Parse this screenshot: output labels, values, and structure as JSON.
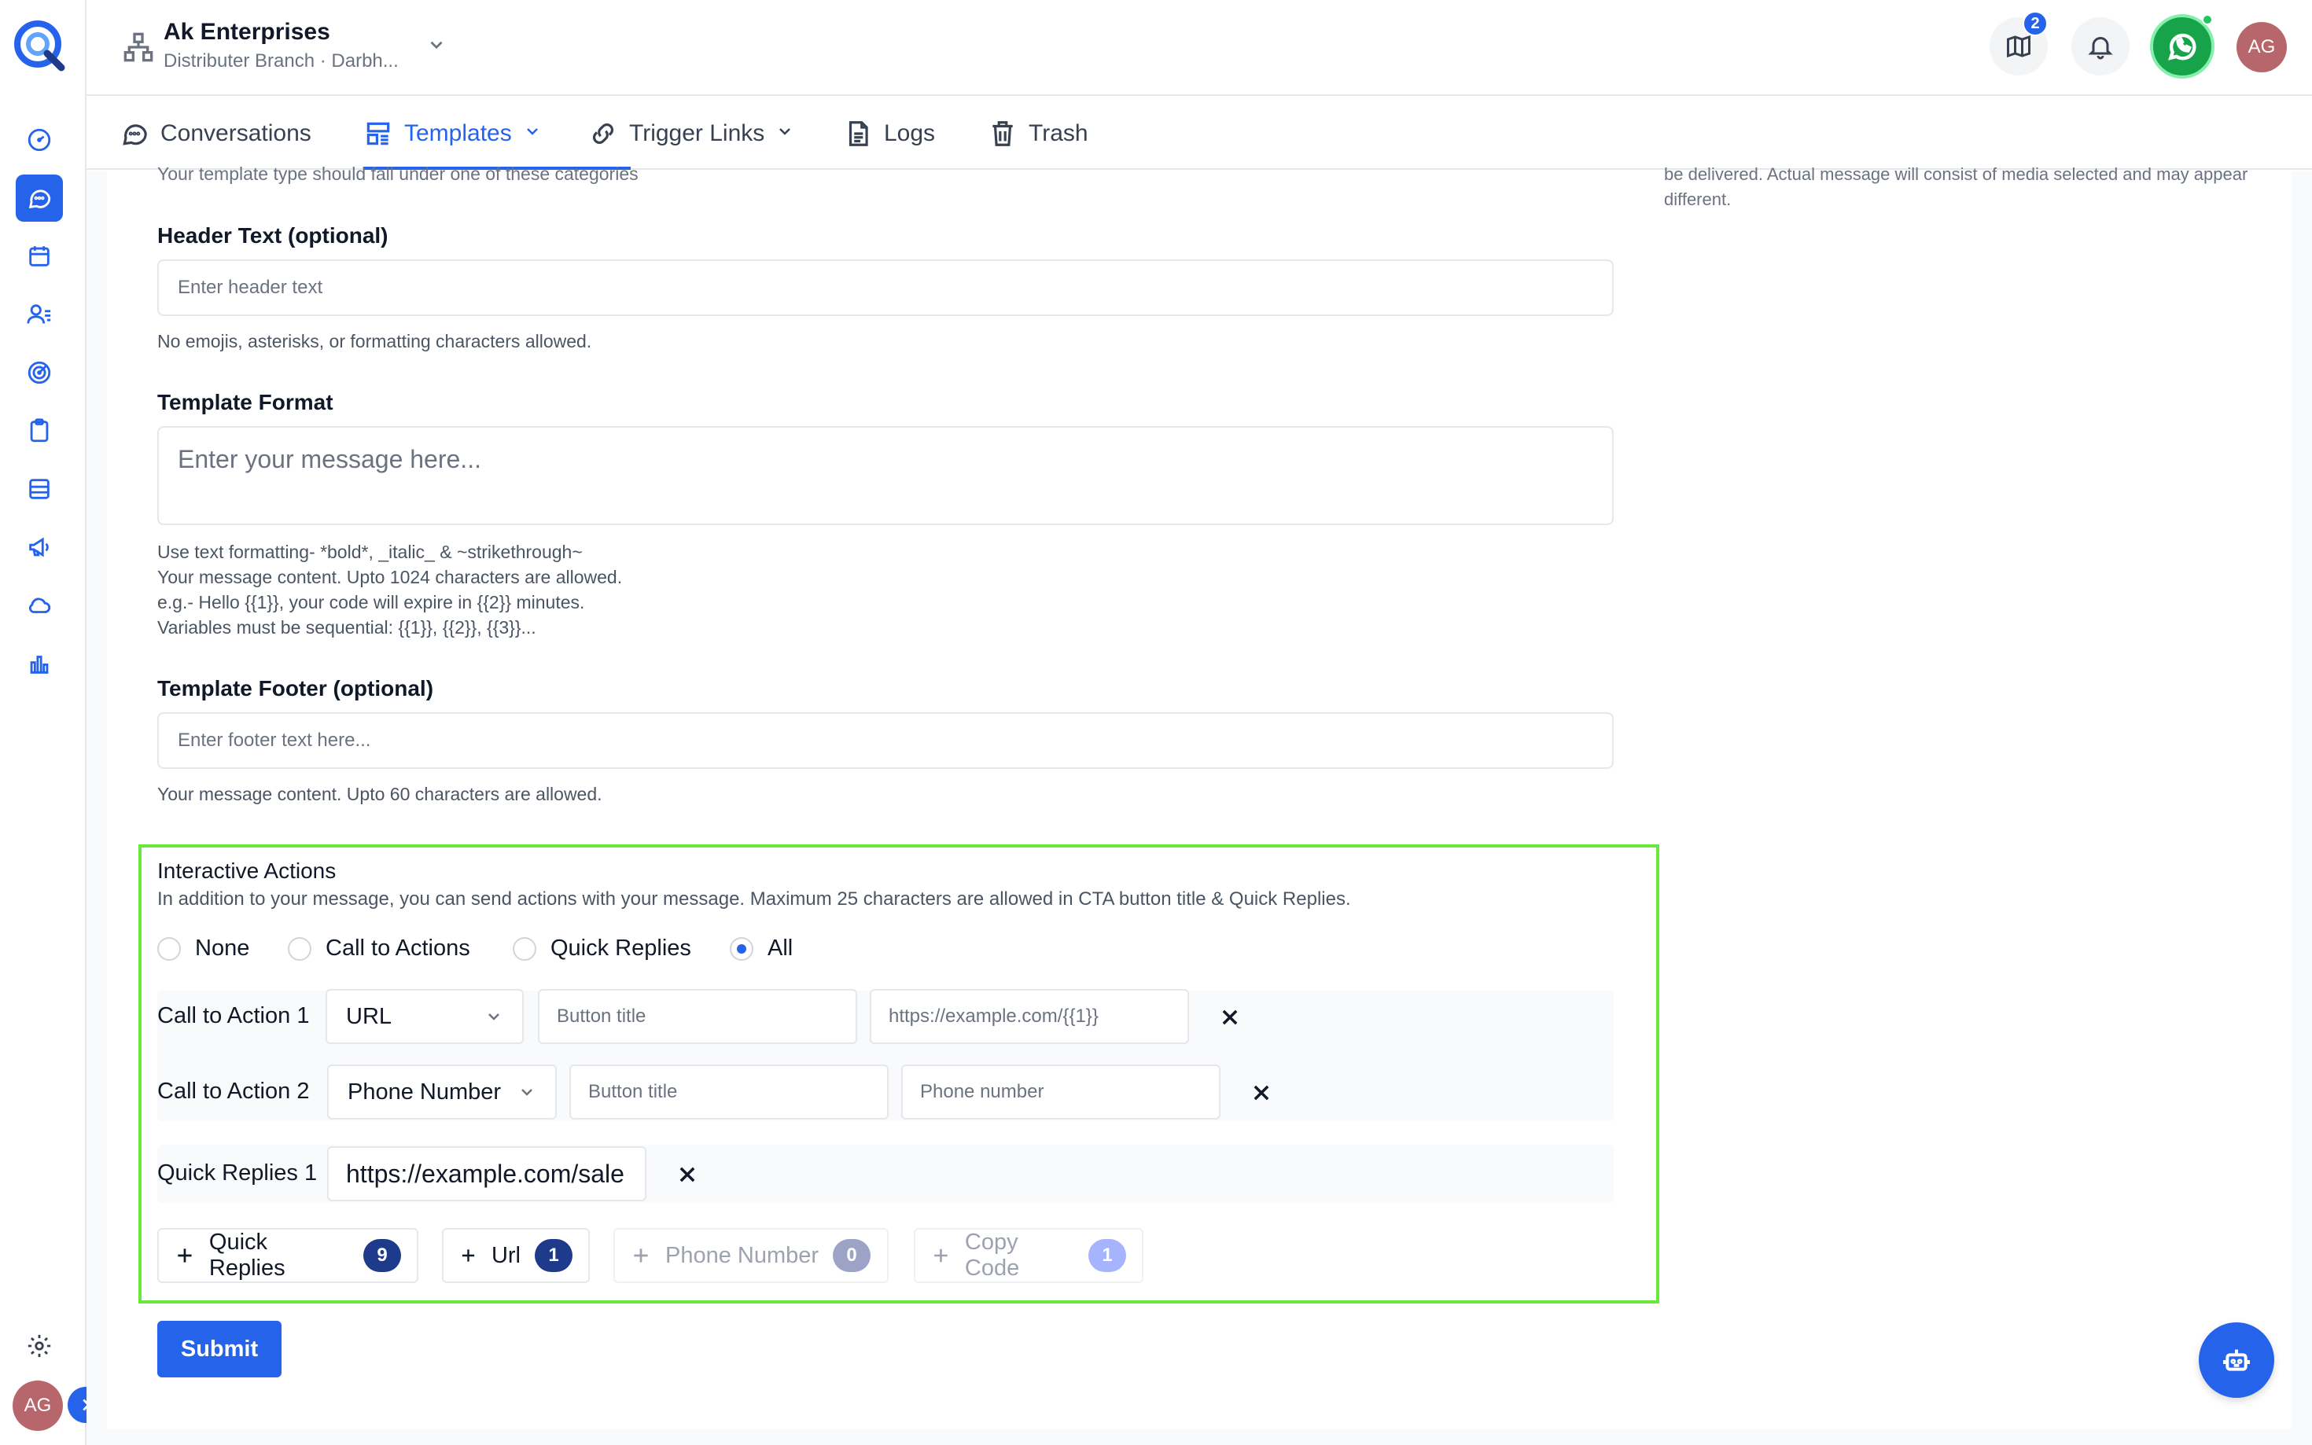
{
  "org": {
    "name": "Ak Enterprises",
    "subtitle": "Distributer Branch · Darbh..."
  },
  "header": {
    "notification_count": "2",
    "avatar_initials": "AG"
  },
  "sidebar": {
    "items": [
      {
        "icon": "dashboard-gauge-icon"
      },
      {
        "icon": "chat-bubble-icon",
        "active": true
      },
      {
        "icon": "calendar-icon"
      },
      {
        "icon": "contacts-list-icon"
      },
      {
        "icon": "target-icon"
      },
      {
        "icon": "clipboard-icon"
      },
      {
        "icon": "layout-icon"
      },
      {
        "icon": "megaphone-icon"
      },
      {
        "icon": "cloud-icon"
      },
      {
        "icon": "bar-chart-icon"
      }
    ],
    "avatar_initials": "AG"
  },
  "tabs": [
    {
      "label": "Conversations",
      "icon": "chat-bubble-icon"
    },
    {
      "label": "Templates",
      "icon": "template-icon",
      "active": true,
      "dropdown": true
    },
    {
      "label": "Trigger Links",
      "icon": "link-icon",
      "dropdown": true
    },
    {
      "label": "Logs",
      "icon": "document-icon"
    },
    {
      "label": "Trash",
      "icon": "trash-icon"
    }
  ],
  "form": {
    "category_helper_cut": "Your template type should fall under one of these categories",
    "right_note": "be delivered. Actual message will consist of media selected and may appear different.",
    "header_label": "Header Text (optional)",
    "header_placeholder": "Enter header text",
    "header_helper": "No emojis, asterisks, or formatting characters allowed.",
    "format_label": "Template Format",
    "format_placeholder": "Enter your message here...",
    "format_helper_1": "Use text formatting- *bold*, _italic_ & ~strikethrough~",
    "format_helper_2": "Your message content. Upto 1024 characters are allowed.",
    "format_helper_3": "e.g.- Hello {{1}}, your code will expire in {{2}} minutes.",
    "format_helper_4": "Variables must be sequential: {{1}}, {{2}}, {{3}}...",
    "footer_label": "Template Footer (optional)",
    "footer_placeholder": "Enter footer text here...",
    "footer_helper": "Your message content. Upto 60 characters are allowed."
  },
  "interactive": {
    "title": "Interactive Actions",
    "description": "In addition to your message, you can send actions with your message. Maximum 25 characters are allowed in CTA button title & Quick Replies.",
    "options": [
      "None",
      "Call to Actions",
      "Quick Replies",
      "All"
    ],
    "selected_option": "All",
    "cta1": {
      "label": "Call to Action 1",
      "type": "URL",
      "title_placeholder": "Button title",
      "value_placeholder": "https://example.com/{{1}}"
    },
    "cta2": {
      "label": "Call to Action 2",
      "type": "Phone Number",
      "title_placeholder": "Button title",
      "value_placeholder": "Phone number"
    },
    "qr1": {
      "label": "Quick Replies 1",
      "value": "https://example.com/sale"
    },
    "add_buttons": [
      {
        "label": "Quick Replies",
        "count": "9"
      },
      {
        "label": "Url",
        "count": "1"
      },
      {
        "label": "Phone Number",
        "count": "0"
      },
      {
        "label": "Copy Code",
        "count": "1"
      }
    ]
  },
  "submit_label": "Submit",
  "colors": {
    "primary": "#2563eb",
    "highlight_border": "#67e83a",
    "whatsapp": "#16a34a",
    "avatar": "#b7676b"
  }
}
